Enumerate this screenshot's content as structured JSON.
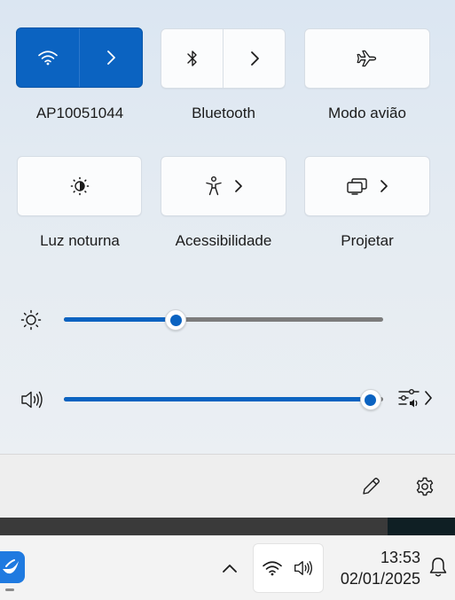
{
  "quick_settings": {
    "tiles_row1": [
      {
        "label": "AP10051044",
        "icon": "wifi-icon",
        "active": true,
        "has_chevron": true
      },
      {
        "label": "Bluetooth",
        "icon": "bluetooth-icon",
        "active": false,
        "has_chevron": true
      },
      {
        "label": "Modo avião",
        "icon": "airplane-icon",
        "active": false,
        "has_chevron": false
      }
    ],
    "tiles_row2": [
      {
        "label": "Luz noturna",
        "icon": "night-light-icon",
        "active": false,
        "has_chevron": false
      },
      {
        "label": "Acessibilidade",
        "icon": "accessibility-icon",
        "active": false,
        "has_chevron": true
      },
      {
        "label": "Projetar",
        "icon": "project-icon",
        "active": false,
        "has_chevron": true
      }
    ],
    "brightness": {
      "icon": "brightness-icon",
      "value_percent": 35
    },
    "volume": {
      "icon": "speaker-icon",
      "value_percent": 96
    },
    "footer": {
      "edit_icon": "pencil-icon",
      "settings_icon": "gear-icon"
    }
  },
  "taskbar": {
    "tray": {
      "chevron_icon": "chevron-up-icon",
      "network_icon": "wifi-icon",
      "volume_icon": "speaker-icon"
    },
    "time": "13:53",
    "date": "02/01/2025",
    "notification_icon": "bell-icon"
  },
  "colors": {
    "accent": "#0b63c1",
    "track": "#7c7c7c"
  }
}
